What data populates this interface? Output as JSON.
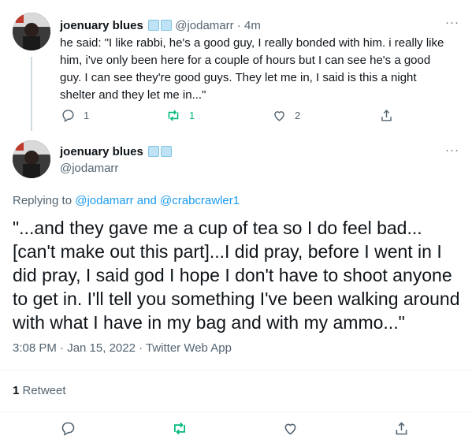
{
  "tweet1": {
    "name": "joenuary blues",
    "handle": "@jodamarr",
    "time": "4m",
    "text": "he said: \"I like rabbi, he's a good guy, I really bonded with him. i really like him, i've only been here for a couple of hours but I can see he's a good guy. I can see they're good guys. They let me in, I said is this a night shelter and they let me in...\"",
    "replies": "1",
    "retweets": "1",
    "likes": "2"
  },
  "tweet2": {
    "name": "joenuary blues",
    "handle": "@jodamarr",
    "replying_prefix": "Replying to ",
    "reply_to_1": "@jodamarr",
    "reply_and": " and ",
    "reply_to_2": "@crabcrawler1",
    "text": "\"...and they gave me a cup of tea so I do feel bad...[can't make out this part]...I did pray, before I went in I did pray, I said god I hope I don't have to shoot anyone to get in. I'll tell you something I've been walking around with what I have in my bag and with my ammo...\"",
    "timestamp": "3:08 PM · Jan 15, 2022 · Twitter Web App",
    "retweet_count": "1",
    "retweet_label": " Retweet"
  },
  "more_glyph": "···",
  "colors": {
    "accent": "#1d9bf0",
    "retweet": "#00ba7c",
    "muted": "#536471",
    "text": "#0f1419"
  },
  "icons": [
    "reply-icon",
    "retweet-icon",
    "like-icon",
    "share-icon",
    "more-icon",
    "ice-cube-emoji"
  ]
}
